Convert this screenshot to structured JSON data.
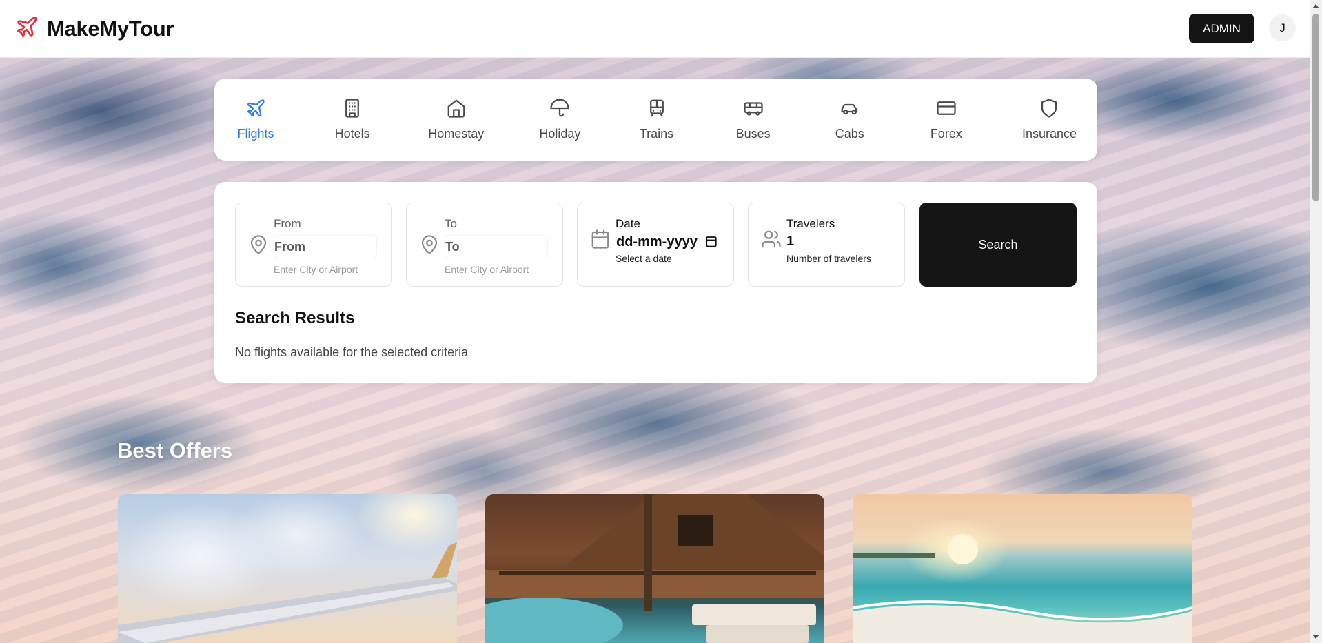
{
  "app": {
    "name": "MakeMyTour"
  },
  "header": {
    "admin_label": "ADMIN",
    "avatar_initial": "J"
  },
  "tabs": [
    {
      "label": "Flights",
      "icon": "plane-icon",
      "active": true
    },
    {
      "label": "Hotels",
      "icon": "building-icon"
    },
    {
      "label": "Homestay",
      "icon": "home-icon"
    },
    {
      "label": "Holiday",
      "icon": "umbrella-icon"
    },
    {
      "label": "Trains",
      "icon": "train-icon"
    },
    {
      "label": "Buses",
      "icon": "bus-icon"
    },
    {
      "label": "Cabs",
      "icon": "car-icon"
    },
    {
      "label": "Forex",
      "icon": "credit-card-icon"
    },
    {
      "label": "Insurance",
      "icon": "shield-icon"
    }
  ],
  "search": {
    "from": {
      "label": "From",
      "placeholder": "From",
      "hint": "Enter City or Airport"
    },
    "to": {
      "label": "To",
      "placeholder": "To",
      "hint": "Enter City or Airport"
    },
    "date": {
      "label": "Date",
      "value": "dd-mm-yyyy",
      "hint": "Select a date"
    },
    "travelers": {
      "label": "Travelers",
      "value": "1",
      "hint": "Number of travelers"
    },
    "button_label": "Search"
  },
  "results": {
    "title": "Search Results",
    "empty_message": "No flights available for the selected criteria"
  },
  "offers": {
    "title": "Best Offers"
  },
  "colors": {
    "accent": "#2f7fe0",
    "brand_red": "#e5333f",
    "dark": "#151515"
  }
}
